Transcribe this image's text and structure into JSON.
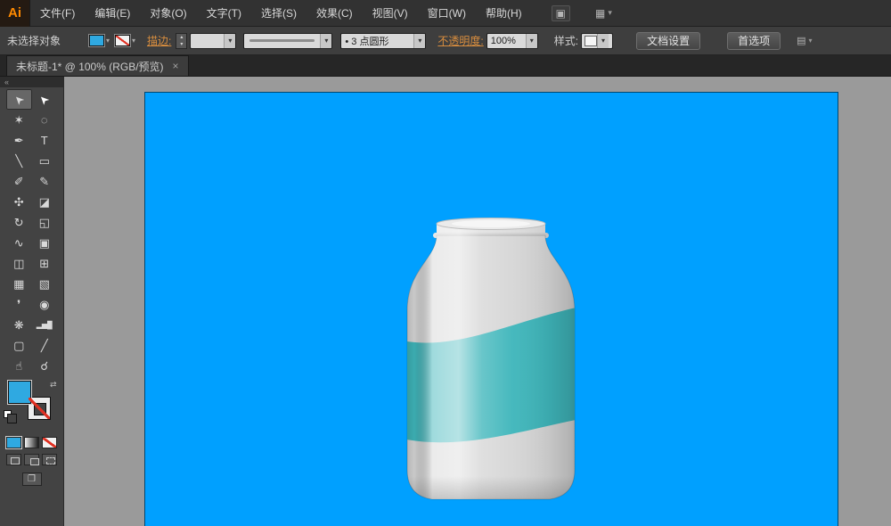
{
  "app": {
    "logo": "Ai"
  },
  "menu_bar": {
    "items": [
      {
        "id": "file",
        "label": "文件(F)"
      },
      {
        "id": "edit",
        "label": "编辑(E)"
      },
      {
        "id": "object",
        "label": "对象(O)"
      },
      {
        "id": "type",
        "label": "文字(T)"
      },
      {
        "id": "select",
        "label": "选择(S)"
      },
      {
        "id": "effect",
        "label": "效果(C)"
      },
      {
        "id": "view",
        "label": "视图(V)"
      },
      {
        "id": "window",
        "label": "窗口(W)"
      },
      {
        "id": "help",
        "label": "帮助(H)"
      }
    ]
  },
  "control_bar": {
    "selection_status": "未选择对象",
    "stroke_label": "描边:",
    "stroke_weight_value": "",
    "brush_bullet": "•",
    "brush_value": "3 点圆形",
    "opacity_label": "不透明度:",
    "opacity_value": "100%",
    "style_label": "样式:",
    "document_setup_button": "文档设置",
    "preferences_button": "首选项"
  },
  "document_tab": {
    "title": "未标题-1* @ 100% (RGB/预览)"
  },
  "toolbar": {
    "tools": [
      {
        "name": "selection-tool",
        "glyph": "➤",
        "rot": -135,
        "selected": true
      },
      {
        "name": "direct-selection-tool",
        "glyph": "➤",
        "rot": -135,
        "light": true
      },
      {
        "name": "magic-wand-tool",
        "glyph": "✶"
      },
      {
        "name": "lasso-tool",
        "glyph": "◌"
      },
      {
        "name": "pen-tool",
        "glyph": "✒"
      },
      {
        "name": "type-tool",
        "glyph": "T"
      },
      {
        "name": "line-segment-tool",
        "glyph": "╲"
      },
      {
        "name": "rectangle-tool",
        "glyph": "▭"
      },
      {
        "name": "paintbrush-tool",
        "glyph": "✐"
      },
      {
        "name": "pencil-tool",
        "glyph": "✎"
      },
      {
        "name": "blob-brush-tool",
        "glyph": "✣"
      },
      {
        "name": "eraser-tool",
        "glyph": "◪"
      },
      {
        "name": "rotate-tool",
        "glyph": "↻"
      },
      {
        "name": "scale-tool",
        "glyph": "◱"
      },
      {
        "name": "width-tool",
        "glyph": "∿"
      },
      {
        "name": "free-transform-tool",
        "glyph": "▣"
      },
      {
        "name": "shape-builder-tool",
        "glyph": "◫"
      },
      {
        "name": "perspective-grid-tool",
        "glyph": "⊞"
      },
      {
        "name": "mesh-tool",
        "glyph": "▦"
      },
      {
        "name": "gradient-tool",
        "glyph": "▧"
      },
      {
        "name": "eyedropper-tool",
        "glyph": "❜"
      },
      {
        "name": "blend-tool",
        "glyph": "◉"
      },
      {
        "name": "symbol-sprayer-tool",
        "glyph": "❋"
      },
      {
        "name": "column-graph-tool",
        "glyph": "▂▅█",
        "small": true
      },
      {
        "name": "artboard-tool",
        "glyph": "▢"
      },
      {
        "name": "slice-tool",
        "glyph": "╱"
      },
      {
        "name": "hand-tool",
        "glyph": "☝"
      },
      {
        "name": "zoom-tool",
        "glyph": "☌"
      }
    ]
  },
  "icons": {
    "dropdown": "▾",
    "stepper_up": "▴",
    "stepper_down": "▾",
    "close_tab": "×",
    "collapse_panel": "«",
    "swap_colors": "⇄",
    "workspace": "▦",
    "panel_menu": "▤",
    "screen_mode": "❐",
    "menu_extra": "▣"
  },
  "colors": {
    "artboard_blue": "#00A0FF",
    "label_teal": "#3FB6BB",
    "fill_swatch_blue": "#2FA9E1",
    "accent_orange": "#D98E3F"
  },
  "canvas": {
    "artwork_description": "silver aluminum bottle with teal label band on blue artboard"
  }
}
